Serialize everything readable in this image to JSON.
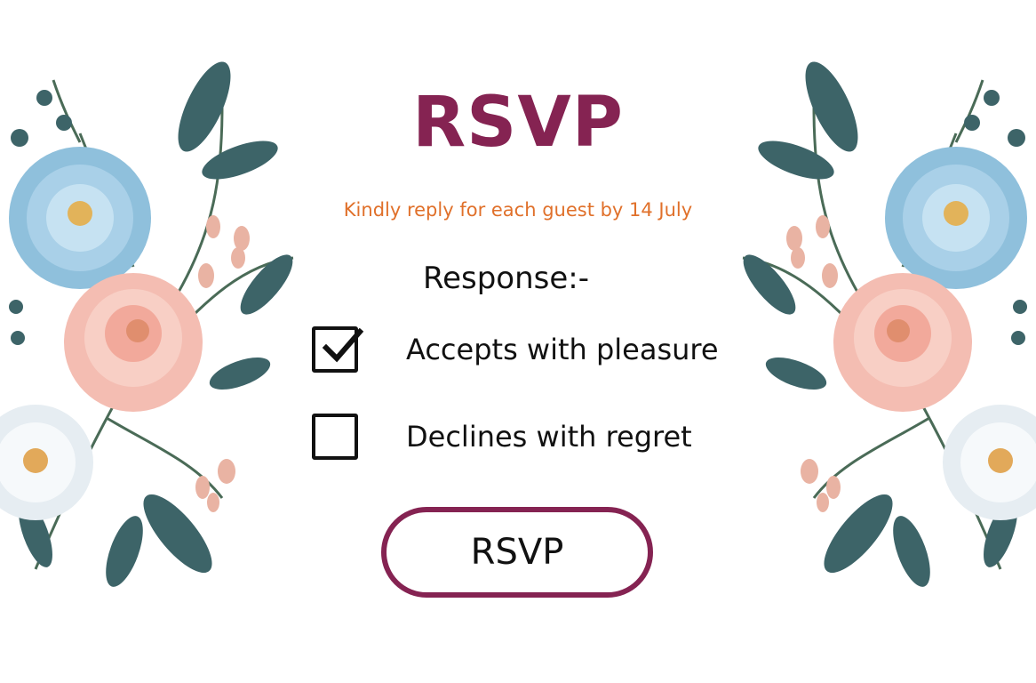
{
  "card": {
    "title": "RSVP",
    "subtitle": "Kindly reply for each guest by 14 July",
    "response_label": "Response:-",
    "options": [
      {
        "label": "Accepts with pleasure",
        "checked": true
      },
      {
        "label": "Declines with regret",
        "checked": false
      }
    ],
    "button_label": "RSVP"
  },
  "colors": {
    "title": "#852352",
    "subtitle": "#e0702a",
    "button_border": "#852352",
    "text": "#111111"
  },
  "decoration": {
    "left": "floral-bouquet",
    "right": "floral-bouquet"
  }
}
